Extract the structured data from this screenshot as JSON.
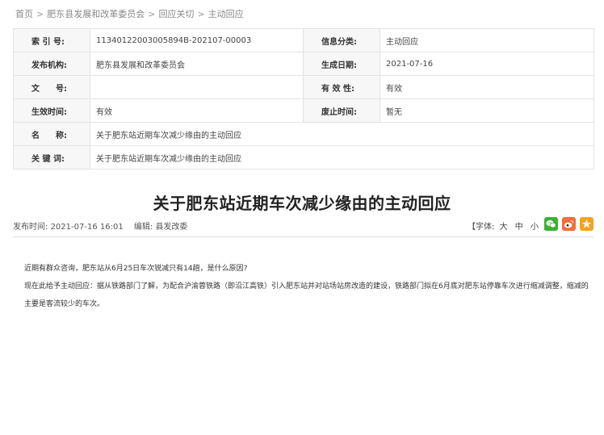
{
  "breadcrumb": {
    "home": "首页",
    "level1": "肥东县发展和改革委员会",
    "level2": "回应关切",
    "level3": "主动回应",
    "separator": ">"
  },
  "meta_table": {
    "index_no_label": "索 引 号:",
    "index_no_value": "11340122003005894B-202107-00003",
    "category_label": "信息分类:",
    "category_value": "主动回应",
    "publisher_label": "发布机构:",
    "publisher_value": "肥东县发展和改革委员会",
    "created_label": "生成日期:",
    "created_value": "2021-07-16",
    "docno_label": "文　　号:",
    "docno_value": "",
    "validity_label": "有 效 性:",
    "validity_value": "有效",
    "effective_label": "生效时间:",
    "effective_value": "有效",
    "expire_label": "废止时间:",
    "expire_value": "暂无",
    "name_label": "名　　称:",
    "name_value": "关于肥东站近期车次减少缘由的主动回应",
    "keywords_label": "关 键 词:",
    "keywords_value": "关于肥东站近期车次减少缘由的主动回应"
  },
  "article": {
    "title": "关于肥东站近期车次减少缘由的主动回应",
    "publish_label": "发布时间:",
    "publish_time": "2021-07-16 16:01",
    "editor_label": "编辑:",
    "editor": "县发改委",
    "font_label": "【字体:",
    "font_large": "大",
    "font_medium": "中",
    "font_small": "小",
    "font_close": "】",
    "paragraph1": "近期有群众咨询，肥东站从6月25日车次锐减只有14趟，是什么原因?",
    "paragraph2": "现在此给予主动回应：据从铁路部门了解，为配合沪渝蓉铁路（即沿江高铁）引入肥东站并对站场站房改造的建设，铁路部门拟在6月底对肥东站停靠车次进行缩减调整，缩减的主要是客流较少的车次。"
  },
  "share": {
    "wechat": {
      "icon": "wechat-icon",
      "color": "#3cb034"
    },
    "weibo": {
      "icon": "weibo-icon",
      "color": "#f26d3c"
    },
    "favorite": {
      "icon": "star-icon",
      "color": "#f4a321"
    }
  }
}
